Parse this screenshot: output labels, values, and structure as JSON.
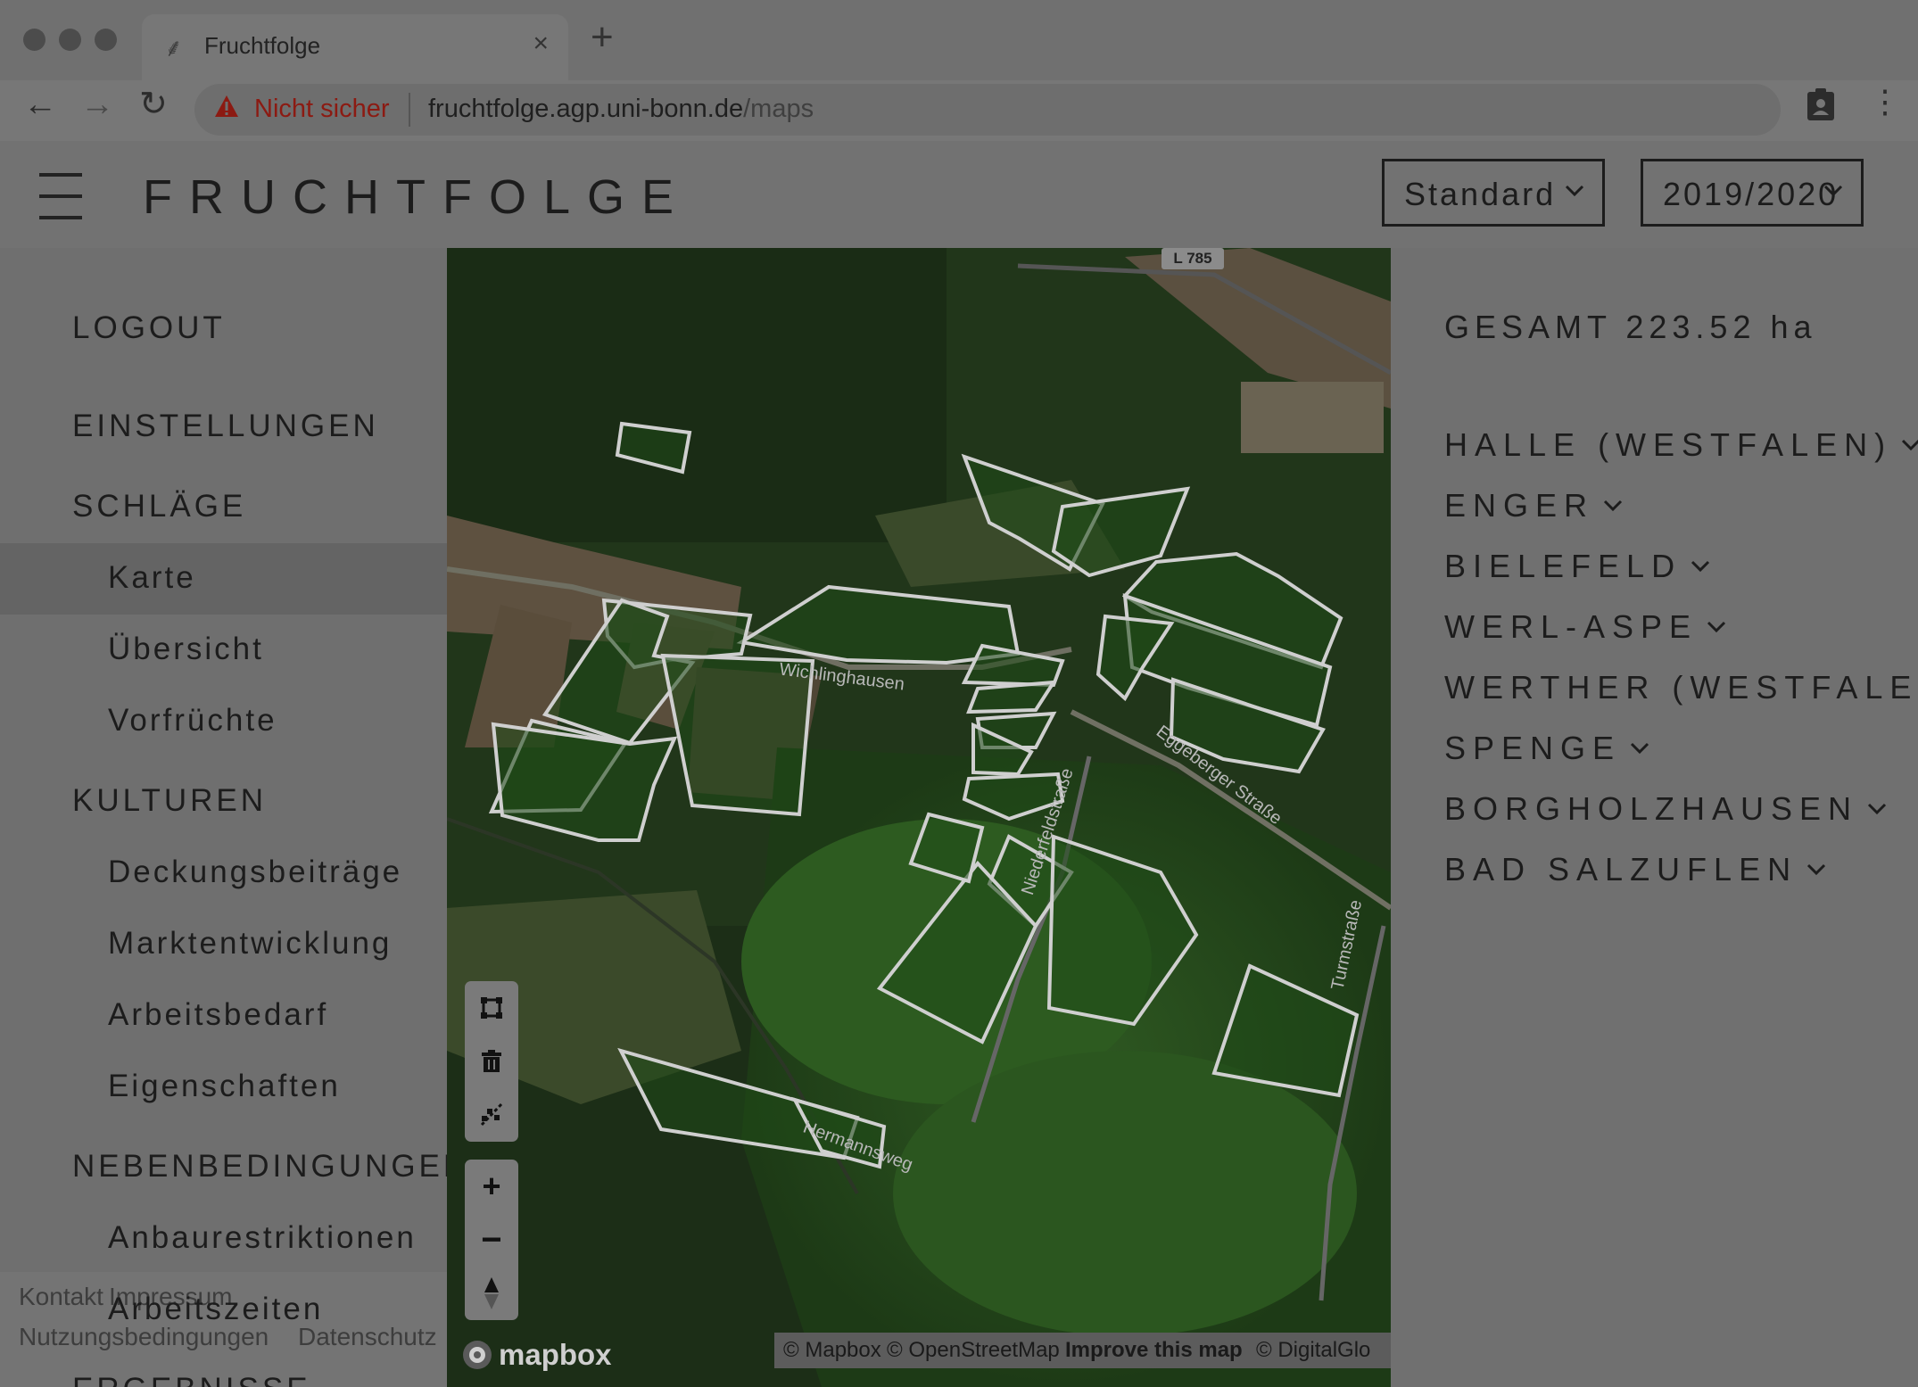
{
  "browser": {
    "tab_title": "Fruchtfolge",
    "insecure_label": "Nicht sicher",
    "url_host": "fruchtfolge.agp.uni-bonn.de",
    "url_path": "/maps"
  },
  "header": {
    "brand": "FRUCHTFOLGE",
    "view_select": "Standard",
    "year_select": "2019/2020"
  },
  "sidebar": {
    "logout": "LOGOUT",
    "settings": "EINSTELLUNGEN",
    "schlaege": "SCHLÄGE",
    "schlaege_items": [
      "Karte",
      "Übersicht",
      "Vorfrüchte"
    ],
    "kulturen": "KULTUREN",
    "kulturen_items": [
      "Deckungsbeiträge",
      "Marktentwicklung",
      "Arbeitsbedarf",
      "Eigenschaften"
    ],
    "nebenbedingungen": "NEBENBEDINGUNGEN",
    "nebenbedingungen_items": [
      "Anbaurestriktionen",
      "Arbeitszeiten"
    ],
    "ergebnisse": "ERGEBNISSE",
    "active_item": "Karte"
  },
  "footer": {
    "contact": "Kontakt",
    "impressum": "Impressum",
    "terms": "Nutzungsbedingungen",
    "privacy": "Datenschutz"
  },
  "map": {
    "road_badge": "L 785",
    "labels": {
      "street1": "Wichlinghausen",
      "street2": "Eggeberger Straße",
      "street3": "Turmstraße",
      "street4": "Niederfeldstraße",
      "street5": "Hermannsweg"
    },
    "logo": "mapbox",
    "attribution": {
      "mapbox": "© Mapbox",
      "osm": "© OpenStreetMap",
      "improve": "Improve this map",
      "digitalglobe": "© DigitalGlo"
    }
  },
  "panel": {
    "total": "GESAMT 223.52 ha",
    "locations": [
      "HALLE (WESTFALEN)",
      "ENGER",
      "BIELEFELD",
      "WERL-ASPE",
      "WERTHER (WESTFALEN)",
      "SPENGE",
      "BORGHOLZHAUSEN",
      "BAD SALZUFLEN"
    ]
  },
  "colors": {
    "overlay": "#707070",
    "text": "#1c1c1c",
    "insecure": "#8c1a12",
    "field_outline": "#d0d0d0"
  }
}
